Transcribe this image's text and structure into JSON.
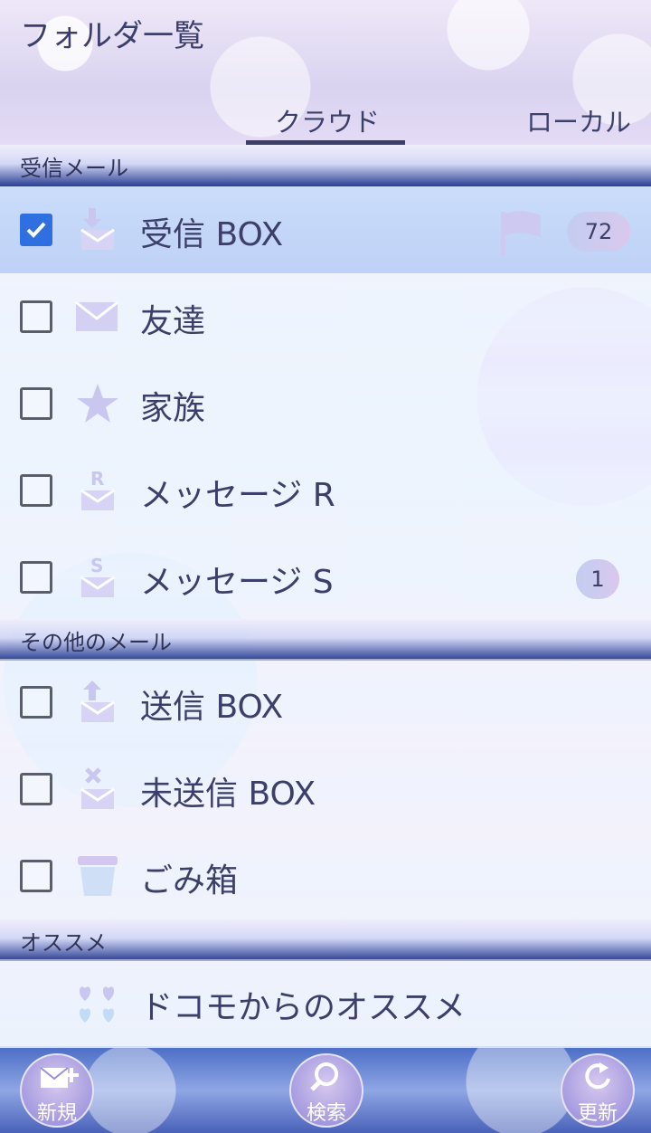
{
  "header": {
    "title": "フォルダ一覧",
    "tabs": [
      {
        "label": "クラウド",
        "active": true
      },
      {
        "label": "ローカル",
        "active": false
      }
    ]
  },
  "sections": [
    {
      "title": "受信メール",
      "items": [
        {
          "label": "受信 BOX",
          "checked": true,
          "icon": "inbox-icon",
          "flag": true,
          "badge": "72"
        },
        {
          "label": "友達",
          "checked": false,
          "icon": "envelope-icon"
        },
        {
          "label": "家族",
          "checked": false,
          "icon": "star-icon"
        },
        {
          "label": "メッセージ R",
          "checked": false,
          "icon": "message-r-icon"
        },
        {
          "label": "メッセージ S",
          "checked": false,
          "icon": "message-s-icon",
          "badge": "1"
        }
      ]
    },
    {
      "title": "その他のメール",
      "items": [
        {
          "label": "送信 BOX",
          "checked": false,
          "icon": "outbox-icon"
        },
        {
          "label": "未送信 BOX",
          "checked": false,
          "icon": "unsent-icon"
        },
        {
          "label": "ごみ箱",
          "checked": false,
          "icon": "trash-icon"
        }
      ]
    },
    {
      "title": "オススメ",
      "items": [
        {
          "label": "ドコモからのオススメ",
          "icon": "hearts-icon"
        }
      ]
    }
  ],
  "bottom_bar": {
    "new_label": "新規",
    "search_label": "検索",
    "refresh_label": "更新"
  },
  "colors": {
    "accent": "#2f6fe0",
    "text": "#3c3f6a",
    "section_band": "#2a3f93",
    "icon": "#c9c6f0"
  }
}
